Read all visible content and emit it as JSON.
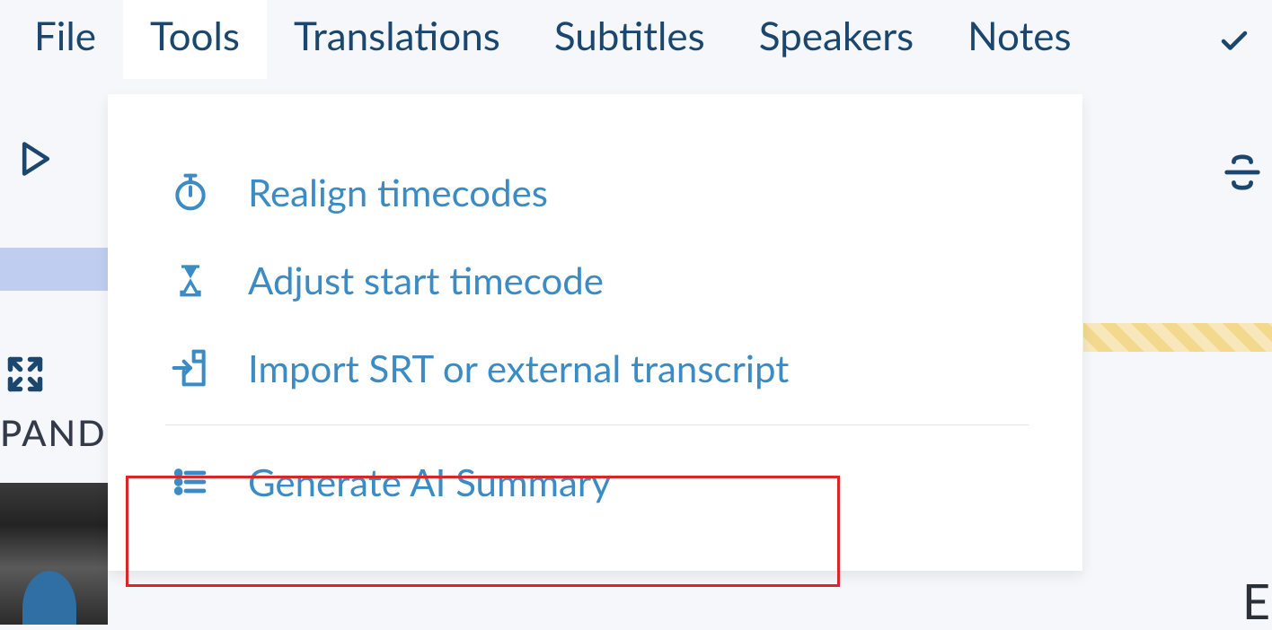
{
  "menubar": {
    "items": [
      {
        "label": "File"
      },
      {
        "label": "Tools"
      },
      {
        "label": "Translations"
      },
      {
        "label": "Subtitles"
      },
      {
        "label": "Speakers"
      },
      {
        "label": "Notes"
      }
    ]
  },
  "dropdown": {
    "items": [
      {
        "label": "Realign timecodes"
      },
      {
        "label": "Adjust start timecode"
      },
      {
        "label": "Import SRT or external transcript"
      },
      {
        "label": "Generate AI Summary"
      }
    ]
  },
  "sidebar": {
    "partial_text": "PAND",
    "bottom_letter": "E"
  }
}
